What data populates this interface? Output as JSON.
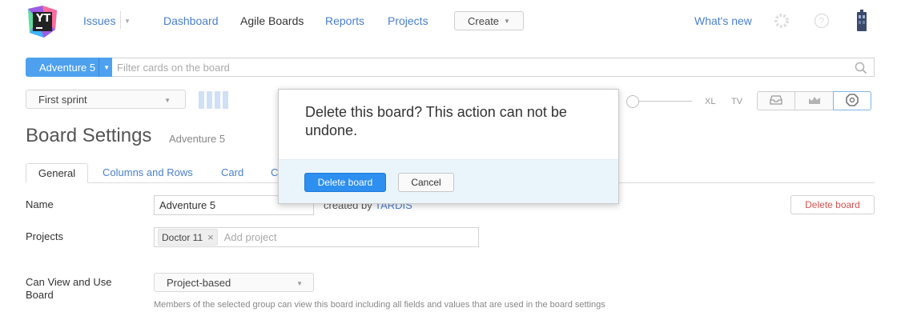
{
  "header": {
    "logo_text": "YT",
    "nav": {
      "issues": "Issues",
      "dashboard": "Dashboard",
      "agile_boards": "Agile Boards",
      "reports": "Reports",
      "projects": "Projects"
    },
    "create_label": "Create",
    "whats_new": "What's new"
  },
  "search": {
    "board_button": "Adventure 5",
    "placeholder": "Filter cards on the board"
  },
  "toolbar": {
    "sprint": "First sprint",
    "size_xl": "XL",
    "size_tv": "TV"
  },
  "settings": {
    "title": "Board Settings",
    "subtitle": "Adventure 5",
    "tabs": [
      "General",
      "Columns and Rows",
      "Card",
      "C"
    ],
    "name_label": "Name",
    "name_value": "Adventure 5",
    "created_by_prefix": "created by",
    "created_by_user": "TARDIS",
    "delete_board": "Delete board",
    "projects_label": "Projects",
    "project_chip": "Doctor 11",
    "chip_remove": "×",
    "add_project": "Add project",
    "visibility_label_1": "Can View and Use",
    "visibility_label_2": "Board",
    "visibility_value": "Project-based",
    "hint": "Members of the selected group can view this board including all fields and values that are used in the board settings"
  },
  "dialog": {
    "message": "Delete this board? This action can not be undone.",
    "confirm": "Delete board",
    "cancel": "Cancel"
  },
  "colors": {
    "link": "#4a7fcf",
    "primary": "#2d8ff0",
    "danger": "#d9534f",
    "dialog_footer": "#eaf5fb"
  },
  "icons": [
    "youtrack-logo-icon",
    "gear-icon",
    "help-icon",
    "user-avatar-icon",
    "search-icon",
    "inbox-icon",
    "chart-icon",
    "settings-icon"
  ]
}
